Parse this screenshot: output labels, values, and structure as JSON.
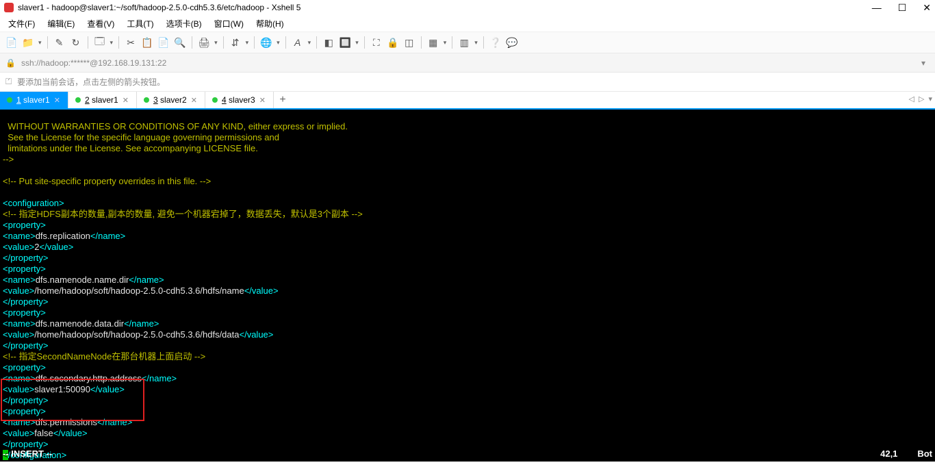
{
  "window": {
    "title": "slaver1 - hadoop@slaver1:~/soft/hadoop-2.5.0-cdh5.3.6/etc/hadoop - Xshell 5",
    "btn_min": "—",
    "btn_max": "☐",
    "btn_close": "✕"
  },
  "menu": {
    "file": "文件(F)",
    "edit": "编辑(E)",
    "view": "查看(V)",
    "tool": "工具(T)",
    "tab": "选项卡(B)",
    "window": "窗口(W)",
    "help": "帮助(H)"
  },
  "address": {
    "value": "ssh://hadoop:******@192.168.19.131:22"
  },
  "hint": {
    "text": "要添加当前会话，点击左侧的箭头按钮。"
  },
  "tabs": [
    {
      "num": "1",
      "label": "slaver1",
      "active": true
    },
    {
      "num": "2",
      "label": "slaver1",
      "active": false
    },
    {
      "num": "3",
      "label": "slaver2",
      "active": false
    },
    {
      "num": "4",
      "label": "slaver3",
      "active": false
    }
  ],
  "term": {
    "l1": "  WITHOUT WARRANTIES OR CONDITIONS OF ANY KIND, either express or implied.",
    "l2": "  See the License for the specific language governing permissions and",
    "l3": "  limitations under the License. See accompanying LICENSE file.",
    "l4": "-->",
    "l5": "",
    "l6": "<!-- Put site-specific property overrides in this file. -->",
    "l7": "",
    "cfg_open": "<configuration>",
    "cmt1": "<!-- 指定HDFS副本的数量,副本的数量, 避免一个机器宕掉了，数据丢失，默认是3个副本 -->",
    "prop": "<property>",
    "prop_c": "</property>",
    "name_o": "<name>",
    "name_c": "</name>",
    "val_o": "<value>",
    "val_c": "</value>",
    "n1": "dfs.replication",
    "v1": "2",
    "n2": "dfs.namenode.name.dir",
    "v2": "/home/hadoop/soft/hadoop-2.5.0-cdh5.3.6/hdfs/name",
    "n3": "dfs.namenode.data.dir",
    "v3": "/home/hadoop/soft/hadoop-2.5.0-cdh5.3.6/hdfs/data",
    "cmt2": "<!-- 指定SecondNameNode在那台机器上面启动 -->",
    "n4": "dfs.secondary.http.address",
    "v4": "slaver1:50090",
    "n5": "dfs.permissions",
    "v5": "false",
    "cfg_close_pre": "<",
    "cfg_close_rest": "/configuration>",
    "tilde": "~",
    "insert": "-- INSERT --",
    "pos": "42,1",
    "bot": "Bot"
  }
}
